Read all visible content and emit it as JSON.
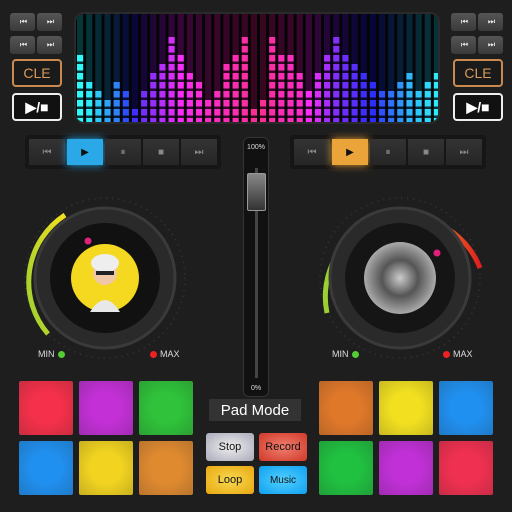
{
  "left_deck": {
    "small_buttons": [
      "⏮",
      "⏭",
      "⏮",
      "⏭"
    ],
    "cle_label": "CLE",
    "play_stop_label": "▶/■",
    "transport": [
      "⏮",
      "▶",
      "⏸",
      "■",
      "⏭"
    ],
    "active": "play",
    "accent": "#2aa8e8",
    "min_label": "MIN",
    "max_label": "MAX",
    "pads": [
      "#f5304a",
      "#c230d6",
      "#2fc23a",
      "#2090f0",
      "#f2d420",
      "#e08a30"
    ]
  },
  "right_deck": {
    "small_buttons": [
      "⏮",
      "⏭",
      "⏮",
      "⏭"
    ],
    "cle_label": "CLE",
    "play_stop_label": "▶/■",
    "transport": [
      "⏮",
      "▶",
      "⏸",
      "■",
      "⏭"
    ],
    "active": "play",
    "accent": "#eaa43a",
    "min_label": "MIN",
    "max_label": "MAX",
    "pads": [
      "#e0782a",
      "#f2e020",
      "#2090f0",
      "#20c040",
      "#c030d6",
      "#f03050"
    ]
  },
  "crossfader": {
    "top_label": "100%",
    "bottom_label": "0%",
    "value_percent": 100
  },
  "spectrum": {
    "levels": [
      8,
      5,
      4,
      3,
      5,
      4,
      2,
      4,
      6,
      7,
      10,
      8,
      6,
      5,
      3,
      4,
      7,
      8,
      10,
      2,
      3,
      10,
      8,
      8,
      6,
      4,
      6,
      8,
      10,
      8,
      7,
      6,
      5,
      4,
      4,
      5,
      6,
      4,
      5,
      6
    ]
  },
  "pad_mode": {
    "title": "Pad Mode",
    "buttons": [
      "Stop",
      "Record",
      "Loop",
      "Music"
    ]
  }
}
